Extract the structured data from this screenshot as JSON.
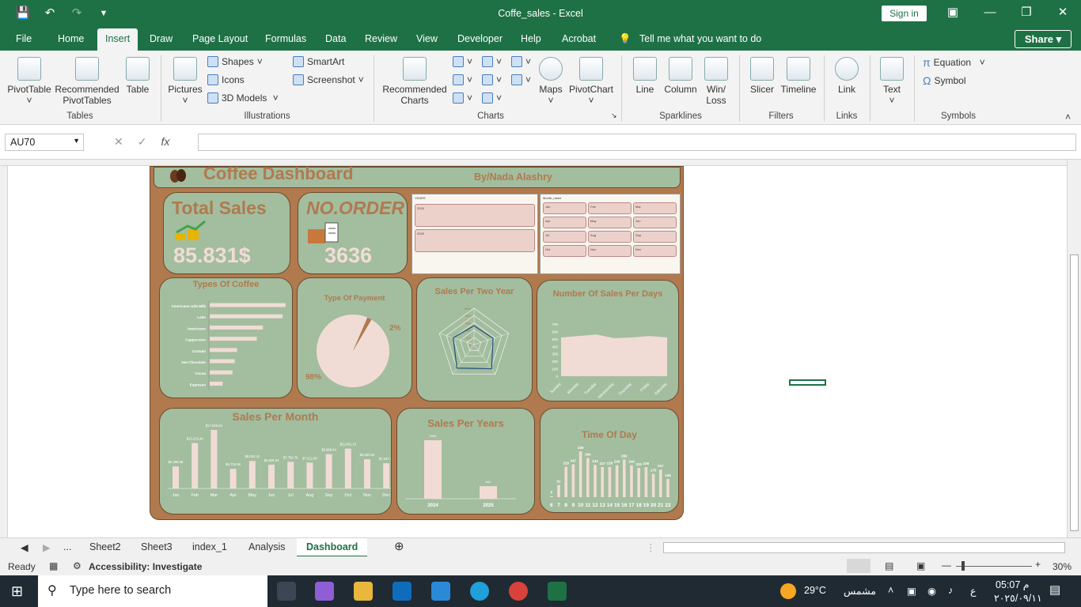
{
  "window": {
    "title": "Coffe_sales  -  Excel",
    "sign_in": "Sign in",
    "share": "Share"
  },
  "menu": {
    "tabs": [
      "File",
      "Home",
      "Insert",
      "Draw",
      "Page Layout",
      "Formulas",
      "Data",
      "Review",
      "View",
      "Developer",
      "Help",
      "Acrobat"
    ],
    "active": "Insert",
    "tell_me": "Tell me what you want to do"
  },
  "ribbon": {
    "tables": {
      "pivot": "PivotTable",
      "recommended_line1": "Recommended",
      "recommended_line2": "PivotTables",
      "table": "Table",
      "group": "Tables"
    },
    "illustrations": {
      "pictures": "Pictures",
      "shapes": "Shapes",
      "icons": "Icons",
      "models": "3D Models",
      "smartart": "SmartArt",
      "screenshot": "Screenshot",
      "group": "Illustrations"
    },
    "charts": {
      "recommended_line1": "Recommended",
      "recommended_line2": "Charts",
      "maps": "Maps",
      "pivotchart": "PivotChart",
      "group": "Charts"
    },
    "sparklines": {
      "line": "Line",
      "column": "Column",
      "winloss_line1": "Win/",
      "winloss_line2": "Loss",
      "group": "Sparklines"
    },
    "filters": {
      "slicer": "Slicer",
      "timeline": "Timeline",
      "group": "Filters"
    },
    "links": {
      "link": "Link",
      "group": "Links"
    },
    "text": {
      "text": "Text"
    },
    "symbols": {
      "equation": "Equation",
      "symbol": "Symbol",
      "group": "Symbols"
    }
  },
  "formula_bar": {
    "name_box": "AU70",
    "fx": "fx",
    "value": ""
  },
  "dashboard": {
    "title": "Coffee Dashboard",
    "author": "By/Nada Alashry",
    "total_sales_label": "Total Sales",
    "total_sales_value": "85.831$",
    "orders_label": "NO.ORDER",
    "orders_value": "3636",
    "slicer_years": {
      "header": "YEARS",
      "items": [
        "2024",
        "2025"
      ]
    },
    "slicer_months": {
      "header": "Month_name",
      "items": [
        "Jan",
        "Feb",
        "Mar",
        "Apr",
        "May",
        "Jun",
        "Jul",
        "Aug",
        "Sep",
        "Oct",
        "Nov",
        "Dec"
      ]
    }
  },
  "chart_data": [
    {
      "type": "bar",
      "title": "Types Of Coffee",
      "categories": [
        "Americano with Milk",
        "Latte",
        "Americano",
        "Cappuccino",
        "Cortado",
        "Hot Chocolate",
        "Cocoa",
        "Espresso"
      ],
      "values": [
        100,
        96,
        70,
        62,
        36,
        33,
        30,
        17
      ]
    },
    {
      "type": "pie",
      "title": "Type Of Payment",
      "values": [
        98,
        2
      ],
      "labels": [
        "98%",
        "2%"
      ],
      "colors": [
        "#f1dcd5",
        "#b07a4e"
      ]
    },
    {
      "type": "radar",
      "title": "Sales Per Two Year",
      "scale_labels": [
        "1000",
        "800",
        "600",
        "400",
        "200",
        "0"
      ]
    },
    {
      "type": "area",
      "title": "Number Of Sales Per Days",
      "categories": [
        "Sunday",
        "Monday",
        "Tuesday",
        "Wednesday",
        "Thursday",
        "Friday",
        "Saturday"
      ],
      "values": [
        520,
        540,
        560,
        510,
        520,
        540,
        520
      ],
      "ylim": [
        0,
        700
      ],
      "yticks": [
        "700",
        "600",
        "500",
        "400",
        "300",
        "200",
        "100",
        "0"
      ]
    },
    {
      "type": "bar",
      "title": "Sales Per Month",
      "categories": [
        "Jan",
        "Feb",
        "Mar",
        "Apr",
        "May",
        "Jun",
        "Jul",
        "Aug",
        "Sep",
        "Oct",
        "Nov",
        "Dec"
      ],
      "values": [
        6398.86,
        13215.48,
        17030.84,
        5700.56,
        8003.42,
        6935.94,
        7756.76,
        7512.88,
        9988.64,
        11601.16,
        8500.54,
        7337.74
      ],
      "labels": [
        "$6,398.86",
        "$13,215.48",
        "$17,030.84",
        "$5,700.56",
        "$8,003.42",
        "$6,935.94",
        "$7,756.76",
        "$7,512.88",
        "$9,988.64",
        "$11,601.16",
        "$8,500.54",
        "$7,337.74"
      ]
    },
    {
      "type": "bar",
      "title": "Sales Per Years",
      "categories": [
        "2024",
        "2025"
      ],
      "values": [
        2995,
        641
      ]
    },
    {
      "type": "bar",
      "title": "Time Of Day",
      "categories": [
        "6",
        "7",
        "8",
        "9",
        "10",
        "11",
        "12",
        "13",
        "14",
        "15",
        "16",
        "17",
        "18",
        "19",
        "20",
        "21",
        "22"
      ],
      "values": [
        8,
        91,
        229,
        247,
        345,
        294,
        243,
        227,
        228,
        240,
        283,
        240,
        220,
        226,
        175,
        207,
        136
      ],
      "labels": [
        "8",
        "91",
        "229",
        "247",
        "345",
        "294",
        "243",
        "227",
        "228",
        "240",
        "283",
        "240",
        "220",
        "226",
        "175",
        "207",
        "136"
      ]
    }
  ],
  "sheet_tabs": [
    "...",
    "Sheet2",
    "Sheet3",
    "index_1",
    "Analysis",
    "Dashboard"
  ],
  "active_sheet": "Dashboard",
  "status": {
    "ready": "Ready",
    "accessibility": "Accessibility: Investigate",
    "zoom": "30%"
  },
  "taskbar": {
    "search": "Type here to search",
    "temp": "29°C",
    "weather": "مشمس",
    "time": "05:07 م",
    "date": "٢٠٢٥/٠٩/١١",
    "lang": "ع"
  }
}
